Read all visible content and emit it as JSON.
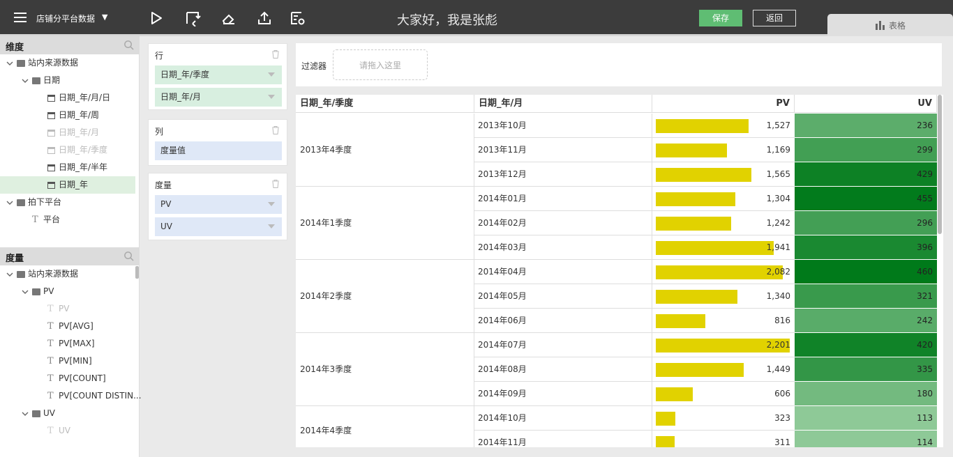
{
  "topbar": {
    "datasource": "店铺分平台数据",
    "title": "大家好，我是张彪",
    "save_label": "保存",
    "back_label": "返回",
    "chart_tab_label": "表格"
  },
  "left": {
    "dimension_header": "维度",
    "dimension_tree": [
      {
        "label": "站内来源数据",
        "icon": "folder",
        "level": 0,
        "arrow": true
      },
      {
        "label": "日期",
        "icon": "folder",
        "level": 1,
        "arrow": true
      },
      {
        "label": "日期_年/月/日",
        "icon": "table",
        "level": 2
      },
      {
        "label": "日期_年/周",
        "icon": "table",
        "level": 2
      },
      {
        "label": "日期_年/月",
        "icon": "table",
        "level": 2,
        "dim": true
      },
      {
        "label": "日期_年/季度",
        "icon": "table",
        "level": 2,
        "dim": true
      },
      {
        "label": "日期_年/半年",
        "icon": "table",
        "level": 2
      },
      {
        "label": "日期_年",
        "icon": "table",
        "level": 2,
        "selected": true
      },
      {
        "label": "拍下平台",
        "icon": "folder",
        "level": 0,
        "arrow": true
      },
      {
        "label": "平台",
        "icon": "text",
        "level": 1
      }
    ],
    "measure_header": "度量",
    "measure_tree": [
      {
        "label": "站内来源数据",
        "icon": "folder",
        "level": 0,
        "arrow": true
      },
      {
        "label": "PV",
        "icon": "folder",
        "level": 1,
        "arrow": true
      },
      {
        "label": "PV",
        "icon": "text",
        "level": 2,
        "dim": true
      },
      {
        "label": "PV[AVG]",
        "icon": "text",
        "level": 2
      },
      {
        "label": "PV[MAX]",
        "icon": "text",
        "level": 2
      },
      {
        "label": "PV[MIN]",
        "icon": "text",
        "level": 2
      },
      {
        "label": "PV[COUNT]",
        "icon": "text",
        "level": 2
      },
      {
        "label": "PV[COUNT DISTIN...",
        "icon": "text",
        "level": 2
      },
      {
        "label": "UV",
        "icon": "folder",
        "level": 1,
        "arrow": true
      },
      {
        "label": "UV",
        "icon": "text",
        "level": 2,
        "dim": true
      }
    ]
  },
  "config": {
    "rows_title": "行",
    "rows": [
      "日期_年/季度",
      "日期_年/月"
    ],
    "cols_title": "列",
    "cols": [
      "度量值"
    ],
    "measures_title": "度量",
    "measures": [
      "PV",
      "UV"
    ]
  },
  "filter": {
    "label": "过滤器",
    "drop_hint": "请拖入这里"
  },
  "table": {
    "headers": [
      "日期_年/季度",
      "日期_年/月",
      "PV",
      "UV"
    ],
    "quarters": [
      {
        "label": "2013年4季度",
        "rows": 3
      },
      {
        "label": "2014年1季度",
        "rows": 3
      },
      {
        "label": "2014年2季度",
        "rows": 3
      },
      {
        "label": "2014年3季度",
        "rows": 3
      },
      {
        "label": "2014年4季度",
        "rows": 2
      }
    ],
    "rows": [
      {
        "month": "2013年10月",
        "pv": "1,527",
        "pv_value": 1527,
        "uv": "236",
        "uv_value": 236
      },
      {
        "month": "2013年11月",
        "pv": "1,169",
        "pv_value": 1169,
        "uv": "299",
        "uv_value": 299
      },
      {
        "month": "2013年12月",
        "pv": "1,565",
        "pv_value": 1565,
        "uv": "429",
        "uv_value": 429
      },
      {
        "month": "2014年01月",
        "pv": "1,304",
        "pv_value": 1304,
        "uv": "455",
        "uv_value": 455
      },
      {
        "month": "2014年02月",
        "pv": "1,242",
        "pv_value": 1242,
        "uv": "296",
        "uv_value": 296
      },
      {
        "month": "2014年03月",
        "pv": "1,941",
        "pv_value": 1941,
        "uv": "396",
        "uv_value": 396
      },
      {
        "month": "2014年04月",
        "pv": "2,082",
        "pv_value": 2082,
        "uv": "460",
        "uv_value": 460
      },
      {
        "month": "2014年05月",
        "pv": "1,340",
        "pv_value": 1340,
        "uv": "321",
        "uv_value": 321
      },
      {
        "month": "2014年06月",
        "pv": "816",
        "pv_value": 816,
        "uv": "242",
        "uv_value": 242
      },
      {
        "month": "2014年07月",
        "pv": "2,201",
        "pv_value": 2201,
        "uv": "420",
        "uv_value": 420
      },
      {
        "month": "2014年08月",
        "pv": "1,449",
        "pv_value": 1449,
        "uv": "335",
        "uv_value": 335
      },
      {
        "month": "2014年09月",
        "pv": "606",
        "pv_value": 606,
        "uv": "180",
        "uv_value": 180
      },
      {
        "month": "2014年10月",
        "pv": "323",
        "pv_value": 323,
        "uv": "113",
        "uv_value": 113
      },
      {
        "month": "2014年11月",
        "pv": "311",
        "pv_value": 311,
        "uv": "114",
        "uv_value": 114
      }
    ]
  },
  "colors": {
    "bar": "#e1d200",
    "uv_low": "#8ec997",
    "uv_high": "#007a1a",
    "save": "#5fbd73"
  }
}
